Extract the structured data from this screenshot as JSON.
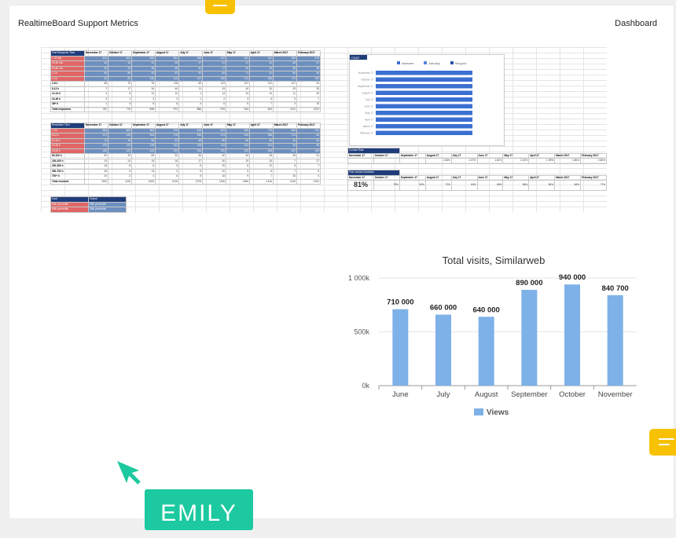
{
  "header": {
    "title": "RealtimeBoard Support Metrics",
    "dashboard_label": "Dashboard"
  },
  "user": {
    "name": "EMILY",
    "color": "#1cc9a0"
  },
  "colors": {
    "sticky": "#f8c100",
    "bar": "#7eb1e8",
    "header": "#1f3d7a",
    "red": "#e06666",
    "blue_cell": "#6d8fbf"
  },
  "first_response": {
    "title": "First Response Time",
    "columns": [
      "November 17",
      "October 17",
      "September 17",
      "August 17",
      "July 17",
      "June 17",
      "May 17",
      "April 17",
      "March 2017",
      "February 2017"
    ],
    "rows": [
      {
        "label": "< 15 min",
        "values": [
          "610",
          "602",
          "566",
          "561",
          "548",
          "492",
          "451",
          "411",
          "539",
          "470"
        ],
        "kind": "red"
      },
      {
        "label": "15-30 min",
        "values": [
          "44",
          "32",
          "42",
          "26",
          "27",
          "41",
          "47",
          "42",
          "68",
          "37"
        ],
        "kind": "red"
      },
      {
        "label": "30-60 min",
        "values": [
          "40",
          "32",
          "46",
          "48",
          "40",
          "27",
          "40",
          "39",
          "68",
          "35"
        ],
        "kind": "red"
      },
      {
        "label": "1-2 h",
        "values": [
          "54",
          "55",
          "43",
          "52",
          "52",
          "65",
          "71",
          "42",
          "66",
          "56"
        ],
        "kind": "red"
      },
      {
        "label": "2-4 h",
        "values": [
          "61",
          "87",
          "136",
          "116",
          "127",
          "165",
          "174",
          "156",
          "170",
          "202"
        ],
        "kind": "red"
      },
      {
        "label": "2-8 h",
        "values": [
          "66",
          "70",
          "76",
          "118",
          "66",
          "123",
          "107",
          "122",
          "107",
          "94"
        ],
        "kind": "plain"
      },
      {
        "label": "8-12 h",
        "values": [
          "7",
          "17",
          "34",
          "40",
          "11",
          "43",
          "40",
          "30",
          "25",
          "35"
        ],
        "kind": "plain"
      },
      {
        "label": "12-24 h",
        "values": [
          "4",
          "5",
          "13",
          "10",
          "1",
          "14",
          "24",
          "14",
          "11",
          "20"
        ],
        "kind": "plain"
      },
      {
        "label": "24-48 h",
        "values": [
          "2",
          "1",
          "3",
          "2",
          "1",
          "2",
          "3",
          "5",
          "9",
          "7"
        ],
        "kind": "plain"
      },
      {
        "label": "48+ h",
        "values": [
          "1",
          "3",
          "5",
          "6",
          "4",
          "6",
          "5",
          "7",
          "3",
          "10"
        ],
        "kind": "plain"
      },
      {
        "label": "Total responses",
        "values": [
          "787",
          "776",
          "836",
          "972",
          "886",
          "876",
          "943",
          "823",
          "1121",
          "1021"
        ],
        "kind": "plain"
      }
    ]
  },
  "resolution": {
    "title": "Resolution Time",
    "columns": [
      "November 17",
      "October 17",
      "September 17",
      "August 17",
      "July 17",
      "June 17",
      "May 17",
      "April 17",
      "March 2017",
      "February 2017"
    ],
    "rows": [
      {
        "label": "< 5 h",
        "values": [
          "563",
          "662",
          "663",
          "709",
          "616",
          "624",
          "639",
          "776",
          "636",
          "762"
        ],
        "kind": "red"
      },
      {
        "label": "5-10 h",
        "values": [
          "127",
          "125",
          "164",
          "178",
          "155",
          "174",
          "164",
          "186",
          "173",
          "84"
        ],
        "kind": "red"
      },
      {
        "label": "10-15 h",
        "values": [
          "70",
          "49",
          "66",
          "62",
          "48",
          "55",
          "56",
          "50",
          "46",
          "54"
        ],
        "kind": "red"
      },
      {
        "label": "15-25 h",
        "values": [
          "130",
          "112",
          "136",
          "142",
          "118",
          "113",
          "124",
          "131",
          "94",
          "90"
        ],
        "kind": "red"
      },
      {
        "label": "25-50 h",
        "values": [
          "180",
          "222",
          "243",
          "249",
          "184",
          "220",
          "225",
          "208",
          "167",
          "196"
        ],
        "kind": "red"
      },
      {
        "label": "50-100 h",
        "values": [
          "92",
          "23",
          "60",
          "32",
          "26",
          "40",
          "34",
          "26",
          "26",
          "31"
        ],
        "kind": "plain"
      },
      {
        "label": "100-200 h",
        "values": [
          "19",
          "24",
          "15",
          "16",
          "17",
          "30",
          "19",
          "16",
          "7",
          "27"
        ],
        "kind": "plain"
      },
      {
        "label": "200-350 h",
        "values": [
          "16",
          "8",
          "6",
          "9",
          "8",
          "20",
          "8",
          "12",
          "8",
          "7"
        ],
        "kind": "plain"
      },
      {
        "label": "350-700 h",
        "values": [
          "30",
          "5",
          "13",
          "2",
          "9",
          "22",
          "5",
          "6",
          "7",
          "5"
        ],
        "kind": "plain"
      },
      {
        "label": "700+ h",
        "values": [
          "20",
          "3",
          "4",
          "6",
          "5",
          "16",
          "9",
          "7",
          "30",
          "4"
        ],
        "kind": "plain"
      },
      {
        "label": "Total resolved",
        "values": [
          "1152",
          "1126",
          "1620",
          "1416",
          "1376",
          "1326",
          "1584",
          "1416",
          "1426",
          "1301"
        ],
        "kind": "plain"
      }
    ]
  },
  "goal": {
    "title": "Goal",
    "output": "Output",
    "rows": [
      {
        "label": "50th percentile",
        "value": "50th percentile"
      },
      {
        "label": "90th percentile",
        "value": "90th percentile"
      }
    ]
  },
  "csat": {
    "title": "CSAT",
    "legend": [
      "Awesome",
      "Just okay",
      "Not good"
    ],
    "categories": [
      "November 17",
      "October 17",
      "September 17",
      "August 17",
      "July 17",
      "June 17",
      "May 17",
      "April 17",
      "March 17",
      "February 17"
    ]
  },
  "contact_rate": {
    "title": "Contact Rate",
    "columns": [
      "November 17",
      "October 17",
      "September 17",
      "August 17",
      "July 17",
      "June 17",
      "May 17",
      "April 17",
      "March 2017",
      "February 2017"
    ],
    "values": [
      "",
      "",
      "",
      "2.36%",
      "2.07%",
      "1.81%",
      "2.02%",
      "1.99%",
      "1.80%",
      "2.80%"
    ]
  },
  "first_contact": {
    "title": "First contact resolution",
    "columns": [
      "November 17",
      "October 17",
      "September 17",
      "August 17",
      "July 17",
      "June 17",
      "May 17",
      "April 17",
      "March 2017",
      "February 2017"
    ],
    "values": [
      "81%",
      "75%",
      "90%",
      "72%",
      "64%",
      "66%",
      "56%",
      "56%",
      "66%",
      "77%"
    ]
  },
  "chart_data": {
    "type": "bar",
    "title": "Total visits, Similarweb",
    "categories": [
      "June",
      "July",
      "August",
      "September",
      "October",
      "November"
    ],
    "values": [
      710000,
      660000,
      640000,
      890000,
      940000,
      840700
    ],
    "labels": [
      "710 000",
      "660 000",
      "640 000",
      "890 000",
      "940 000",
      "840 700"
    ],
    "yticks": [
      "0k",
      "500k",
      "1 000k"
    ],
    "ylim": [
      0,
      1000000
    ],
    "series": [
      {
        "name": "Views",
        "values": [
          710000,
          660000,
          640000,
          890000,
          940000,
          840700
        ]
      }
    ],
    "legend_position": "bottom",
    "color": "#7eb1e8"
  }
}
